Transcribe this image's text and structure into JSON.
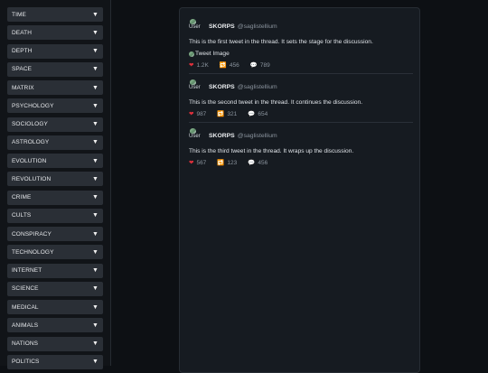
{
  "sidebar": {
    "categories": [
      "TIME",
      "DEATH",
      "DEPTH",
      "SPACE",
      "MATRIX",
      "PSYCHOLOGY",
      "SOCIOLOGY",
      "ASTROLOGY",
      "EVOLUTION",
      "REVOLUTION",
      "CRIME",
      "CULTS",
      "CONSPIRACY",
      "TECHNOLOGY",
      "INTERNET",
      "SCIENCE",
      "MEDICAL",
      "ANIMALS",
      "NATIONS",
      "POLITICS"
    ],
    "arrow": "▼"
  },
  "thread": {
    "tweets": [
      {
        "avatar_alt": "User",
        "name": "SKORPS",
        "handle": "@saglistellium",
        "text": "This is the first tweet in the thread. It sets the stage for the discussion.",
        "image_alt": "Tweet Image",
        "likes": "1.2K",
        "retweets": "456",
        "replies": "789"
      },
      {
        "avatar_alt": "User",
        "name": "SKORPS",
        "handle": "@saglistellium",
        "text": "This is the second tweet in the thread. It continues the discussion.",
        "likes": "987",
        "retweets": "321",
        "replies": "654"
      },
      {
        "avatar_alt": "User",
        "name": "SKORPS",
        "handle": "@saglistellium",
        "text": "This is the third tweet in the thread. It wraps up the discussion.",
        "likes": "567",
        "retweets": "123",
        "replies": "456"
      }
    ],
    "icons": {
      "like": "heart-icon",
      "retweet": "retweet-icon",
      "reply": "reply-icon"
    }
  },
  "colors": {
    "like": "#e0303c",
    "retweet": "#f2a516",
    "accent_bg": "#161b21"
  }
}
